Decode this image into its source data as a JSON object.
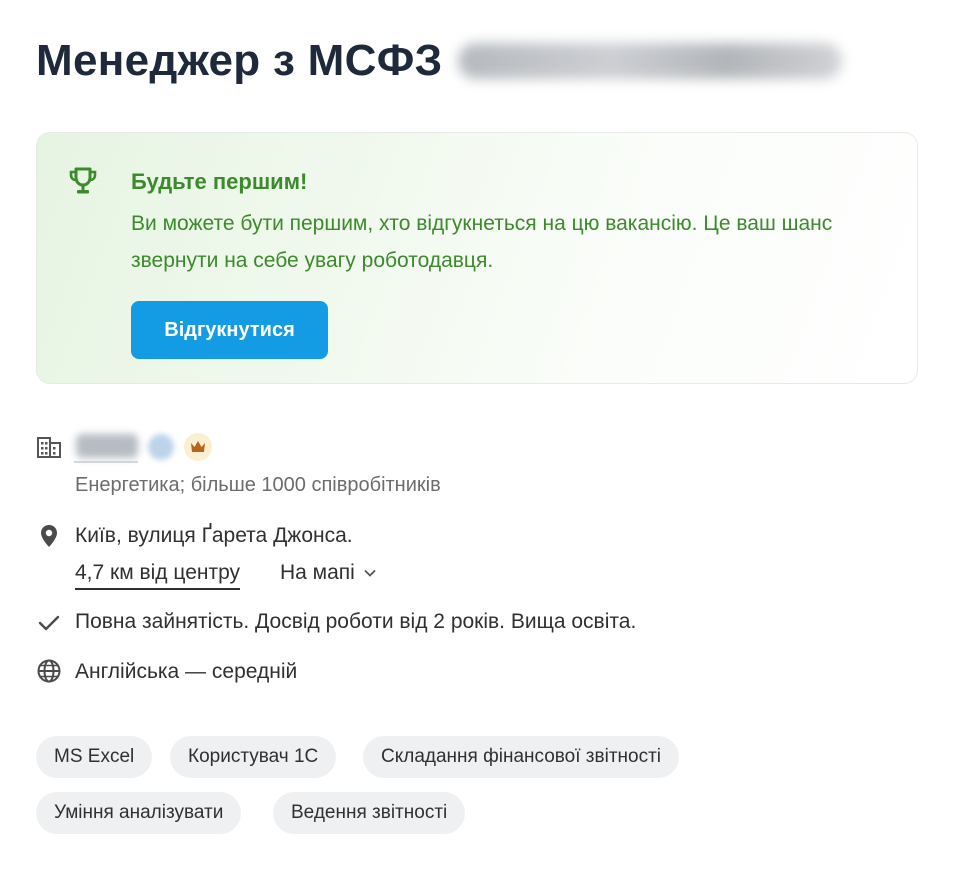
{
  "vacancy": {
    "title": "Менеджер з МСФЗ"
  },
  "banner": {
    "title": "Будьте першим!",
    "text": "Ви можете бути першим, хто відгукнеться на цю вакансію. Це ваш шанс звернути на себе увагу роботодавця.",
    "button_label": "Відгукнутися",
    "accent_color": "#3b8a2b",
    "button_color": "#139be3"
  },
  "company": {
    "industry": "Енергетика; більше 1000 співробітників"
  },
  "location": {
    "address": "Київ, вулиця Ґарета Джонса.",
    "distance": "4,7 км від центру",
    "map_link": "На мапі"
  },
  "conditions": {
    "text": "Повна зайнятість. Досвід роботи від 2 років. Вища освіта."
  },
  "language": {
    "text": "Англійська — середній"
  },
  "icons": {
    "trophy": "trophy-icon",
    "building": "building-icon",
    "verified": "verified-icon",
    "crown": "crown-icon",
    "location": "location-pin-icon",
    "check": "check-icon",
    "globe": "globe-icon",
    "chevron": "chevron-down-icon"
  },
  "skills": [
    "MS Excel",
    "Користувач 1С",
    "Складання фінансової звітності",
    "Уміння аналізувати",
    "Ведення звітності"
  ]
}
